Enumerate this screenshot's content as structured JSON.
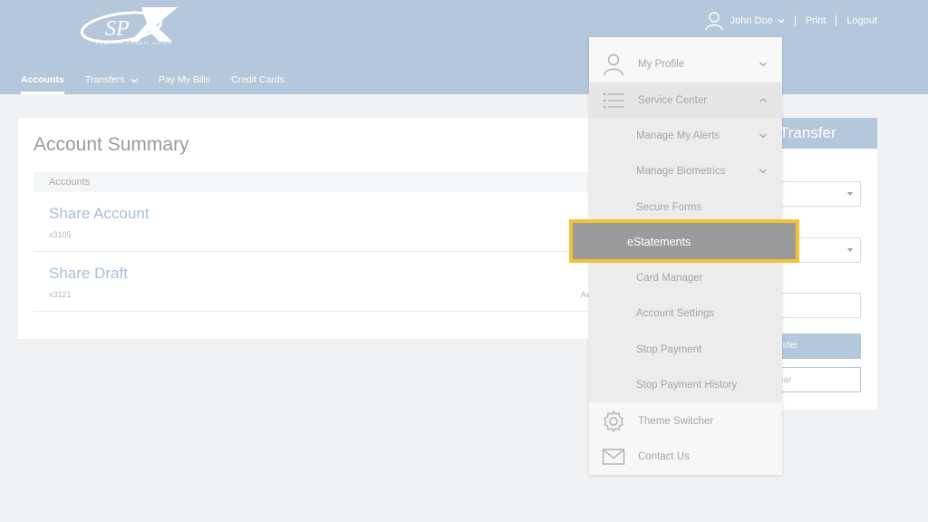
{
  "header": {
    "logo_text": "SPX",
    "logo_subtext": "FEDERAL CREDIT UNION",
    "user_name": "John Doe",
    "print_label": "Print",
    "logout_label": "Logout"
  },
  "nav": {
    "items": [
      {
        "label": "Accounts",
        "active": true
      },
      {
        "label": "Transfers",
        "has_dropdown": true
      },
      {
        "label": "Pay My Bills"
      },
      {
        "label": "Credit Cards"
      }
    ]
  },
  "summary": {
    "title": "Account Summary",
    "column_header": "Accounts",
    "accounts": [
      {
        "name": "Share Account",
        "number": "x3105",
        "available": ""
      },
      {
        "name": "Share Draft",
        "number": "x3121",
        "available": "Avail"
      }
    ]
  },
  "transfer": {
    "title": "Transfer",
    "submit_label": "nsfer",
    "clear_label": "ear"
  },
  "menu": {
    "my_profile": "My Profile",
    "service_center": "Service Center",
    "submenu": [
      "Manage My Alerts",
      "Manage Biometrics",
      "Secure Forms",
      "eStatements",
      "Card Manager",
      "Account Settings",
      "Stop Payment",
      "Stop Payment History"
    ],
    "theme_switcher": "Theme Switcher",
    "contact_us": "Contact Us"
  },
  "colors": {
    "header_bg": "#b5c7da",
    "highlight_border": "#f2c23a",
    "highlight_bg": "#9b9b9b",
    "link": "#a9c0d8"
  }
}
